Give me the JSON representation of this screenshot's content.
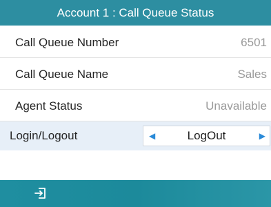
{
  "header": {
    "title": "Account 1 : Call Queue Status"
  },
  "rows": {
    "queue_number": {
      "label": "Call Queue Number",
      "value": "6501"
    },
    "queue_name": {
      "label": "Call Queue Name",
      "value": "Sales"
    },
    "agent_status": {
      "label": "Agent Status",
      "value": "Unavailable"
    },
    "login_logout": {
      "label": "Login/Logout",
      "value": "LogOut"
    }
  },
  "icons": {
    "left_arrow": "◀",
    "right_arrow": "▶",
    "softkey": "logout-icon"
  },
  "colors": {
    "header_bg": "#2d8ea1",
    "softbar_bg": "#1f8ea0",
    "selected_row_bg": "#e7eff8",
    "arrow": "#2a8ad8"
  }
}
